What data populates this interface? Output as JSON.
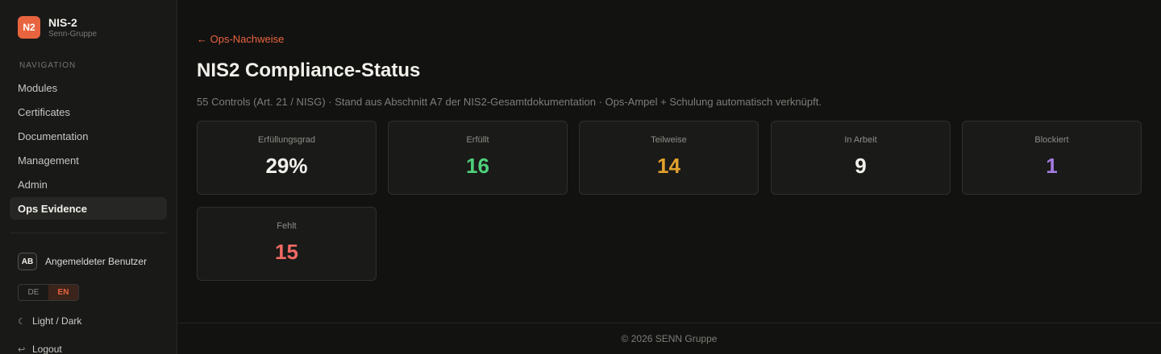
{
  "brand": {
    "logo": "N2",
    "title": "NIS-2",
    "subtitle": "Senn-Gruppe"
  },
  "nav": {
    "heading": "NAVIGATION",
    "items": [
      {
        "label": "Modules"
      },
      {
        "label": "Certificates"
      },
      {
        "label": "Documentation"
      },
      {
        "label": "Management"
      },
      {
        "label": "Admin"
      },
      {
        "label": "Ops Evidence",
        "active": true
      }
    ]
  },
  "user": {
    "initials": "AB",
    "name": "Angemeldeter Benutzer"
  },
  "language": {
    "options": [
      "DE",
      "EN"
    ],
    "selected": "EN"
  },
  "theme_toggle": {
    "icon": "moon-icon",
    "label": "Light / Dark"
  },
  "logout": {
    "icon": "logout-icon",
    "label": "Logout"
  },
  "page": {
    "back_link": "← Ops-Nachweise",
    "title": "NIS2 Compliance-Status",
    "subtitle": "55 Controls (Art. 21 / NISG) · Stand aus Abschnitt A7 der NIS2-Gesamtdokumentation · Ops-Ampel + Schulung automatisch verknüpft."
  },
  "stats": [
    {
      "label": "Erfüllungsgrad",
      "value": "29%",
      "color": "#f2f0ea"
    },
    {
      "label": "Erfüllt",
      "value": "16",
      "color": "#4ed07a"
    },
    {
      "label": "Teilweise",
      "value": "14",
      "color": "#e2a12c"
    },
    {
      "label": "In Arbeit",
      "value": "9",
      "color": "#f2f0ea"
    },
    {
      "label": "Blockiert",
      "value": "1",
      "color": "#a57be3"
    },
    {
      "label": "Fehlt",
      "value": "15",
      "color": "#ef6a63"
    }
  ],
  "footer": "© 2026 SENN Gruppe",
  "colors": {
    "accent": "#e8643f",
    "background": "#121211",
    "sidebar": "#191918",
    "card": "#1a1a19"
  }
}
